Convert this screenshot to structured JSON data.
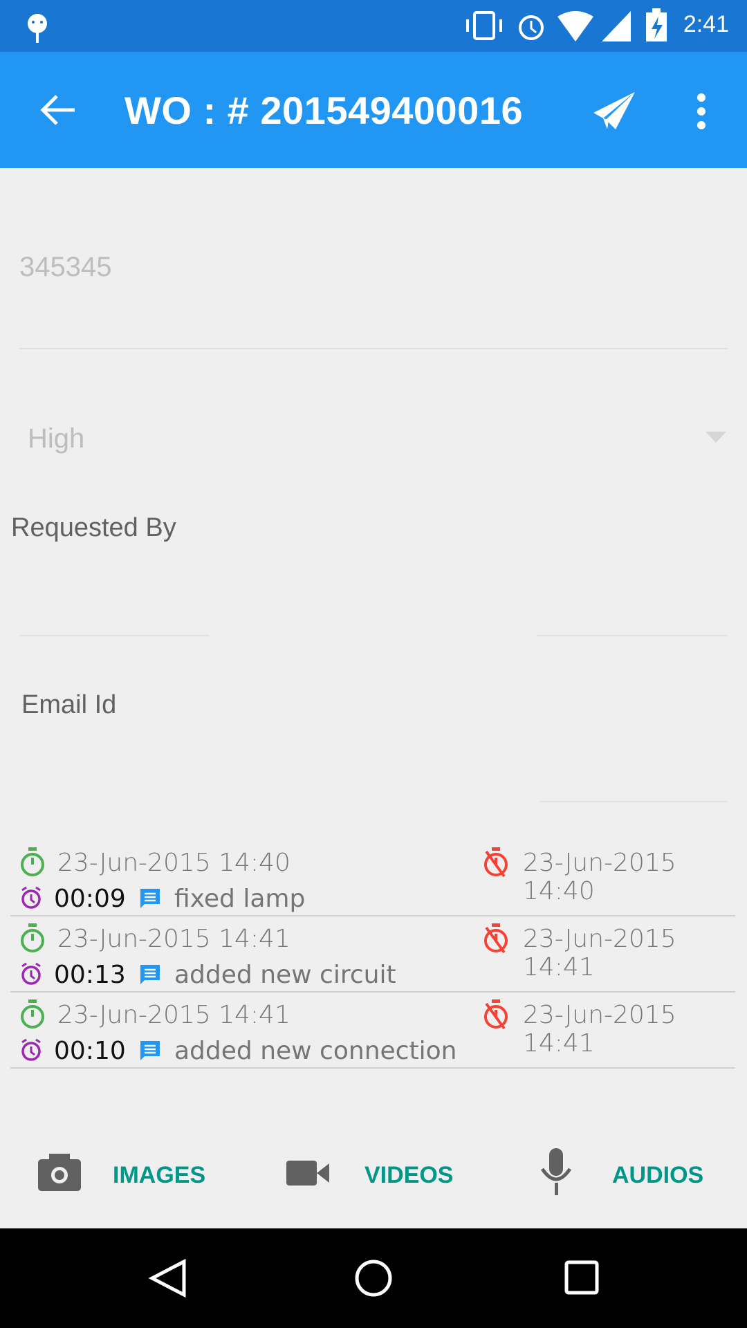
{
  "status_bar": {
    "time": "2:41",
    "icons": [
      "android-debug-icon",
      "vibrate-icon",
      "alarm-icon",
      "wifi-icon",
      "signal-icon",
      "battery-charging-icon"
    ]
  },
  "app_bar": {
    "title": "WO : # 201549400016",
    "icons": [
      "back-arrow-icon",
      "send-icon",
      "more-vert-icon"
    ]
  },
  "form": {
    "field_value": "345345",
    "priority_selected": "High",
    "requested_by_label": "Requested By",
    "email_label": "Email Id"
  },
  "entries": [
    {
      "start": "23-Jun-2015 14:40",
      "end": "23-Jun-2015 14:40",
      "duration": "00:09",
      "note": "fixed lamp"
    },
    {
      "start": "23-Jun-2015 14:41",
      "end": "23-Jun-2015 14:41",
      "duration": "00:13",
      "note": "added new circuit"
    },
    {
      "start": "23-Jun-2015 14:41",
      "end": "23-Jun-2015 14:41",
      "duration": "00:10",
      "note": "added new connection"
    }
  ],
  "media": {
    "images": "IMAGES",
    "videos": "VIDEOS",
    "audios": "AUDIOS"
  },
  "colors": {
    "primary": "#2196F3",
    "primary_dark": "#1976D2",
    "accent": "#009688",
    "start": "#4CAF50",
    "stop": "#F44336",
    "duration": "#9C27B0",
    "note": "#2196F3"
  }
}
